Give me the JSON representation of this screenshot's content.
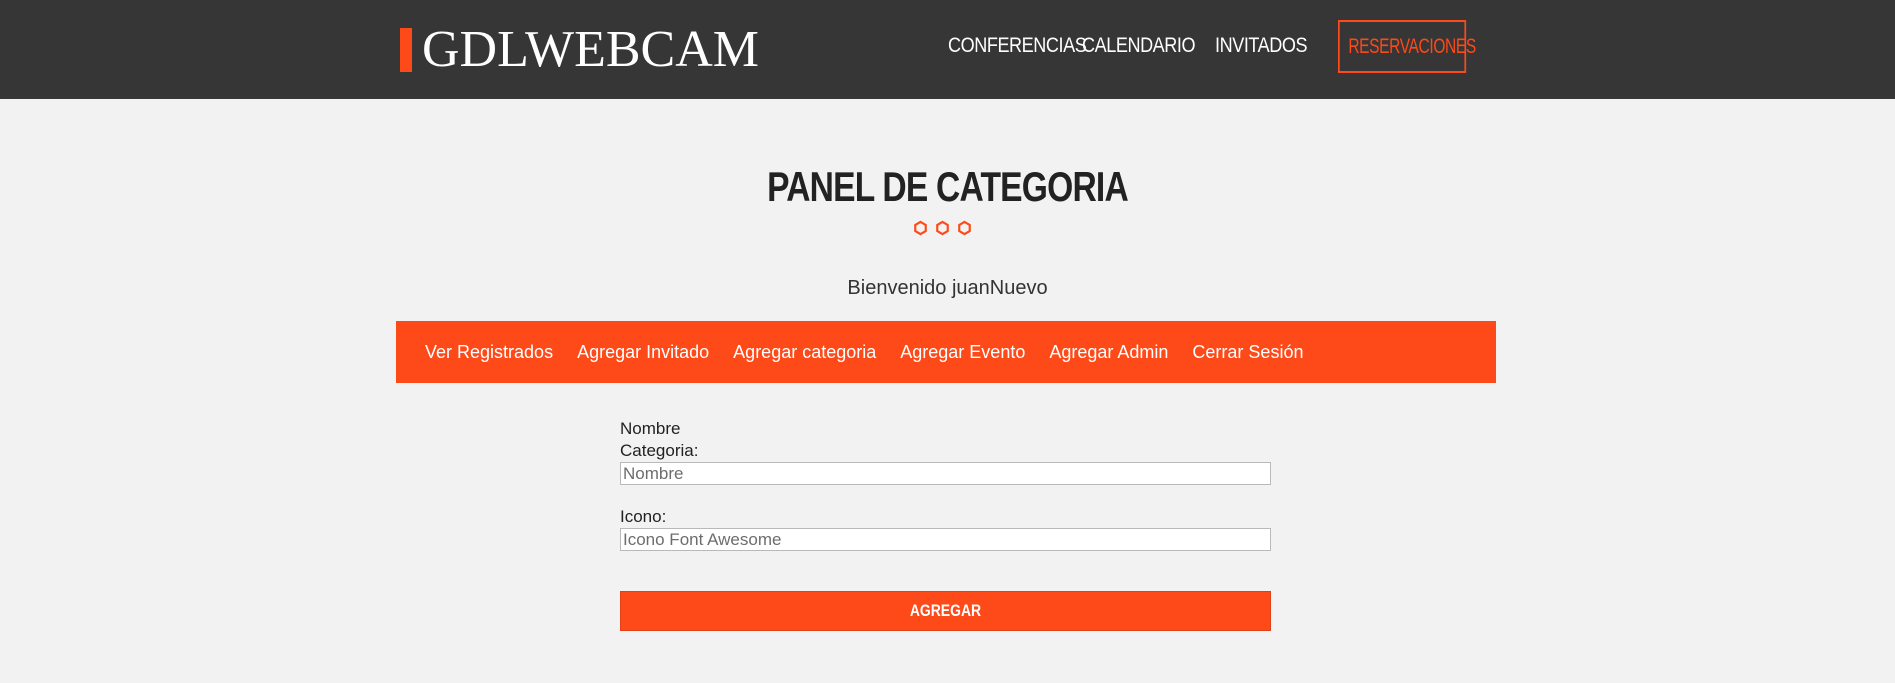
{
  "header": {
    "logo": "GDLWEBCAM",
    "nav": [
      "CONFERENCIAS",
      "CALENDARIO",
      "INVITADOS",
      "RESERVACIONES"
    ]
  },
  "page": {
    "title": "PANEL DE CATEGORIA",
    "welcome": "Bienvenido juanNuevo"
  },
  "admin_menu": [
    "Ver Registrados",
    "Agregar Invitado",
    "Agregar categoria",
    "Agregar Evento",
    "Agregar Admin",
    "Cerrar Sesión"
  ],
  "form": {
    "name_label_line1": "Nombre",
    "name_label_line2": "Categoria:",
    "name_placeholder": "Nombre",
    "icon_label": "Icono:",
    "icon_placeholder": "Icono Font Awesome",
    "submit_label": "AGREGAR"
  },
  "colors": {
    "accent": "#fe4918",
    "header_bg": "#363636",
    "page_bg": "#f2f2f2"
  },
  "icons": {
    "title_ornament": "hexagon-outline-icon"
  }
}
